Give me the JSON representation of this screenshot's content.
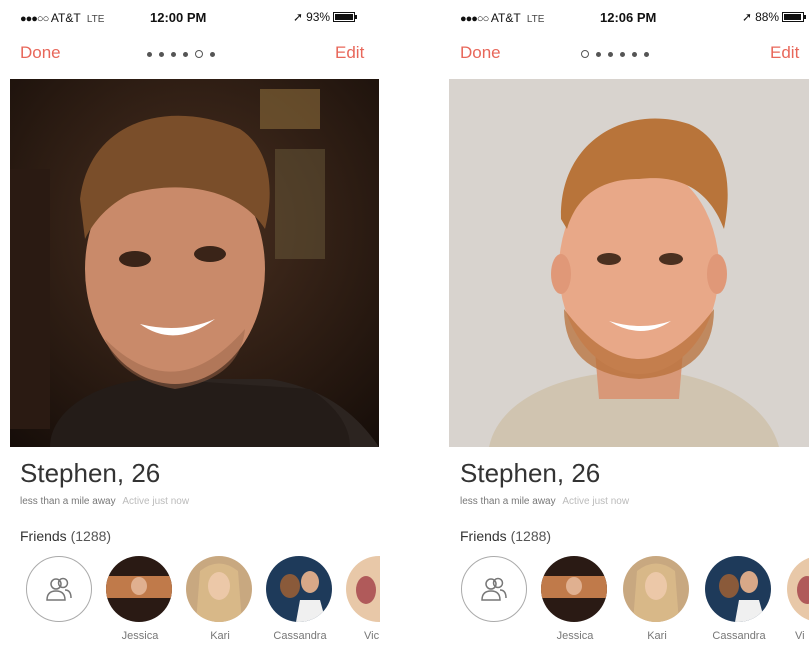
{
  "screens": [
    {
      "status": {
        "carrier": "AT&T",
        "network": "LTE",
        "time": "12:00 PM",
        "battery": "93%",
        "battery_level": 0.93
      },
      "nav": {
        "done": "Done",
        "edit": "Edit",
        "photo_count": 6,
        "active_index": 4
      },
      "profile": {
        "name": "Stephen, 26",
        "distance": "less than a mile away",
        "activity": "Active just now"
      },
      "friends": {
        "label": "Friends",
        "count": "(1288)",
        "names": [
          "Jessica",
          "Kari",
          "Cassandra",
          "Vic"
        ]
      }
    },
    {
      "status": {
        "carrier": "AT&T",
        "network": "LTE",
        "time": "12:06 PM",
        "battery": "88%",
        "battery_level": 0.88
      },
      "nav": {
        "done": "Done",
        "edit": "Edit",
        "photo_count": 6,
        "active_index": 0
      },
      "profile": {
        "name": "Stephen, 26",
        "distance": "less than a mile away",
        "activity": "Active just now"
      },
      "friends": {
        "label": "Friends",
        "count": "(1288)",
        "names": [
          "Jessica",
          "Kari",
          "Cassandra",
          "Vi"
        ]
      }
    }
  ],
  "colors": {
    "accent": "#e8675a",
    "text": "#333333",
    "muted": "#777777"
  },
  "icons": {
    "signal": "signal-dots-icon",
    "location": "location-arrow-icon",
    "battery": "battery-icon",
    "friends": "friends-group-icon"
  }
}
